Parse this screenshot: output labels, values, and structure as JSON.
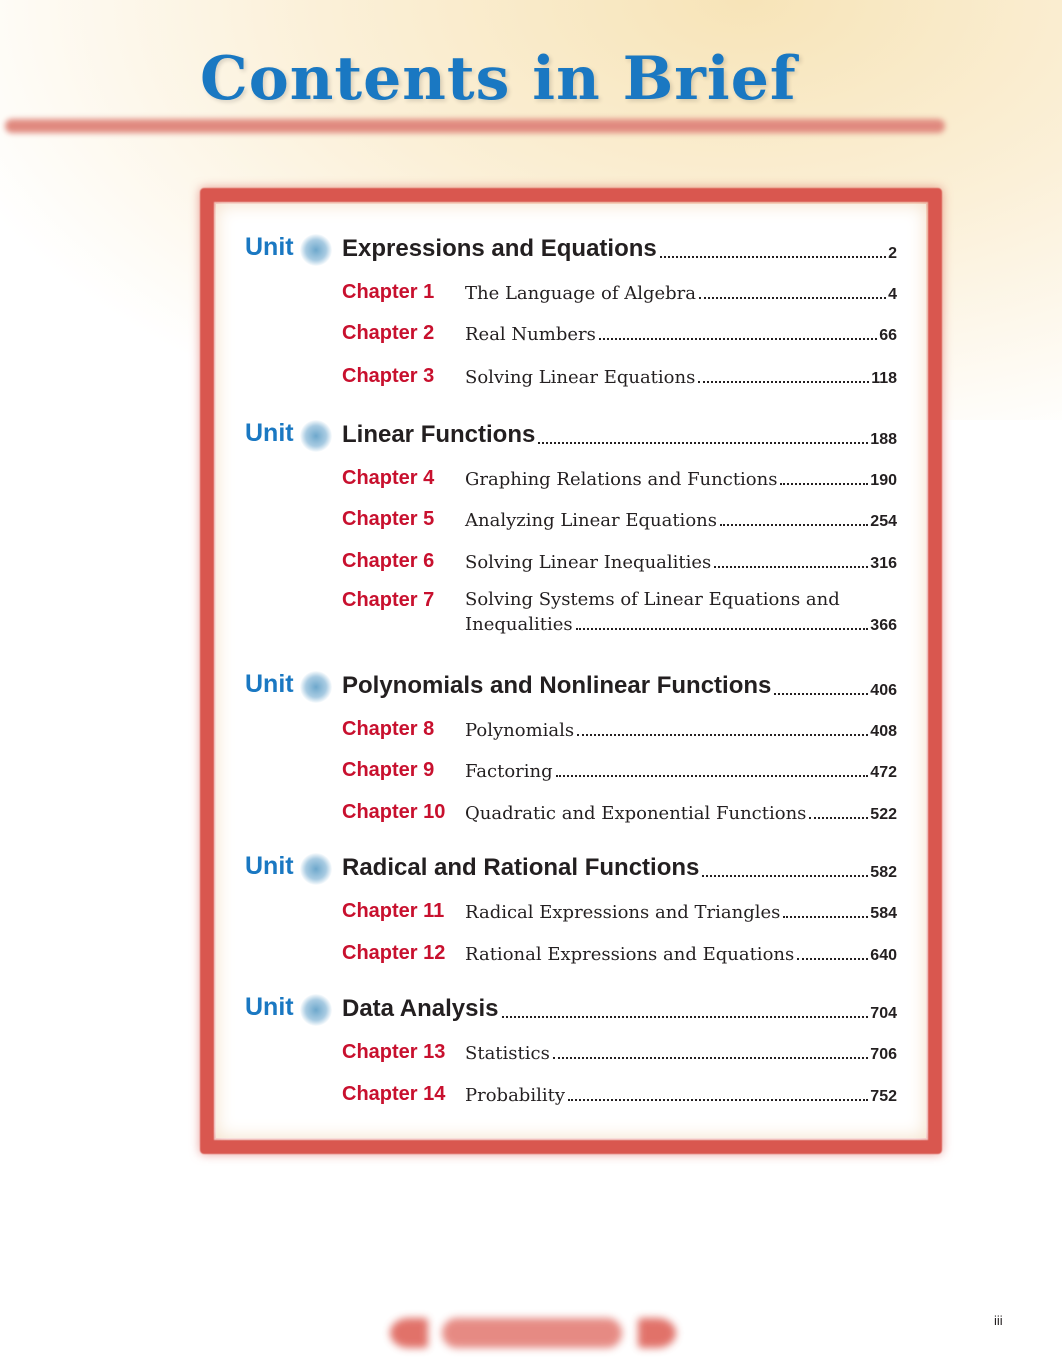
{
  "title": "Contents in Brief",
  "page_number": "iii",
  "unit_label": "Unit",
  "units": [
    {
      "title": "Expressions and Equations",
      "page": "2",
      "chapters": [
        {
          "label": "Chapter 1",
          "title": "The Language of Algebra",
          "page": "4"
        },
        {
          "label": "Chapter 2",
          "title": "Real Numbers",
          "page": "66"
        },
        {
          "label": "Chapter 3",
          "title": "Solving Linear Equations",
          "page": "118"
        }
      ]
    },
    {
      "title": "Linear Functions",
      "page": "188",
      "chapters": [
        {
          "label": "Chapter 4",
          "title": "Graphing Relations and Functions",
          "page": "190"
        },
        {
          "label": "Chapter 5",
          "title": "Analyzing Linear Equations",
          "page": "254"
        },
        {
          "label": "Chapter 6",
          "title": "Solving Linear Inequalities",
          "page": "316"
        },
        {
          "label": "Chapter 7",
          "title": "Solving Systems of Linear Equations and",
          "title2": "Inequalities",
          "page": "366"
        }
      ]
    },
    {
      "title": "Polynomials and Nonlinear Functions",
      "page": "406",
      "chapters": [
        {
          "label": "Chapter 8",
          "title": "Polynomials",
          "page": "408"
        },
        {
          "label": "Chapter 9",
          "title": "Factoring",
          "page": "472"
        },
        {
          "label": "Chapter 10",
          "title": "Quadratic and Exponential Functions",
          "page": "522"
        }
      ]
    },
    {
      "title": "Radical and Rational Functions",
      "page": "582",
      "chapters": [
        {
          "label": "Chapter 11",
          "title": "Radical Expressions and Triangles",
          "page": "584"
        },
        {
          "label": "Chapter 12",
          "title": "Rational Expressions and Equations",
          "page": "640"
        }
      ]
    },
    {
      "title": "Data Analysis",
      "page": "704",
      "chapters": [
        {
          "label": "Chapter 13",
          "title": "Statistics",
          "page": "706"
        },
        {
          "label": "Chapter 14",
          "title": "Probability",
          "page": "752"
        }
      ]
    }
  ],
  "colors": {
    "title": "#1a78c2",
    "chapter": "#c8102e",
    "frame": "#d9574f"
  }
}
